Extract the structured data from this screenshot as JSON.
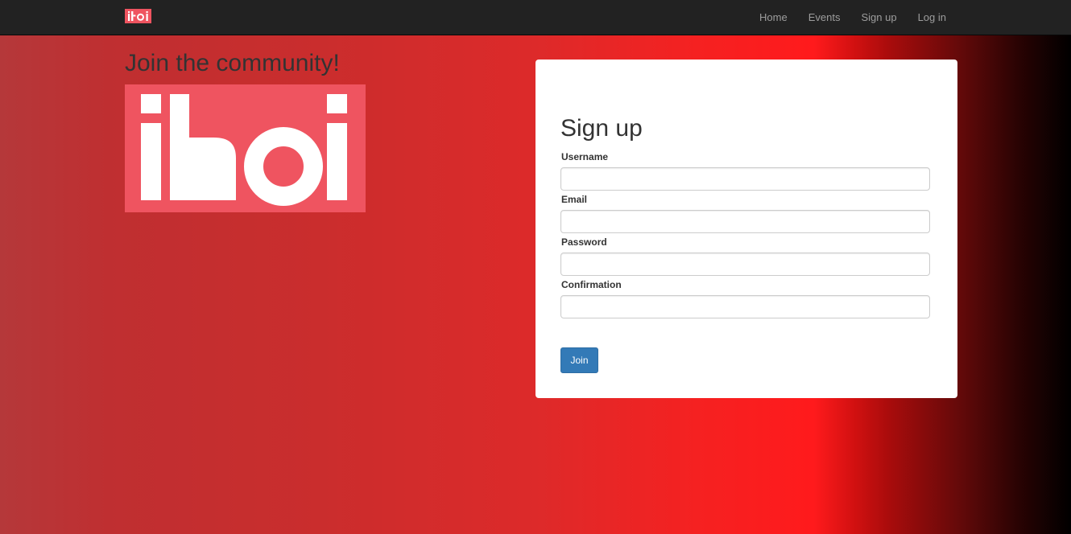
{
  "navbar": {
    "brand": "iKoi",
    "links": [
      "Home",
      "Events",
      "Sign up",
      "Log in"
    ]
  },
  "hero": {
    "title": "Join the community!",
    "logo": "iKoi"
  },
  "signup": {
    "title": "Sign up",
    "fields": [
      {
        "label": "Username",
        "value": ""
      },
      {
        "label": "Email",
        "value": ""
      },
      {
        "label": "Password",
        "value": ""
      },
      {
        "label": "Confirmation",
        "value": ""
      }
    ],
    "submit_label": "Join"
  },
  "colors": {
    "brand": "#ef5460",
    "navbar_bg": "#222222",
    "primary_button": "#337ab7"
  }
}
